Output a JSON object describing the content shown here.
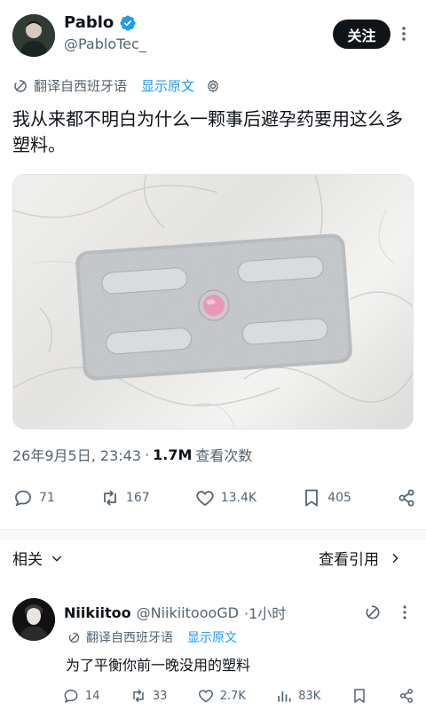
{
  "author": {
    "name": "Pablo",
    "handle": "@PabloTec_"
  },
  "follow_label": "关注",
  "translate": {
    "label": "翻译自西班牙语",
    "show_original": "显示原文"
  },
  "tweet_text": "我从来都不明白为什么一颗事后避孕药要用这么多塑料。",
  "meta": {
    "date": "26年9月5日, 23:43",
    "dot": "·",
    "views": "1.7M",
    "views_label": "查看次数"
  },
  "actions": {
    "replies": "71",
    "retweets": "167",
    "likes": "13.4K",
    "bookmarks": "405"
  },
  "related": {
    "label": "相关",
    "quotes": "查看引用"
  },
  "reply": {
    "name": "Niikiitoo",
    "handle": "@NiikiitoooGD",
    "time": "·1小时",
    "translate_label": "翻译自西班牙语",
    "show_original": "显示原文",
    "text": "为了平衡你前一晚没用的塑料",
    "replies": "14",
    "retweets": "33",
    "likes": "2.7K",
    "views": "83K"
  },
  "colors": {
    "accent": "#1d9bf0",
    "text": "#0f1419",
    "muted": "#536471",
    "pill": "#e79ab7"
  },
  "icons": [
    "verified-icon",
    "more-icon",
    "translate-icon",
    "gear-icon",
    "reply-icon",
    "retweet-icon",
    "like-icon",
    "bookmark-icon",
    "share-icon",
    "chevron-down-icon",
    "chevron-right-icon",
    "views-icon",
    "grok-icon"
  ]
}
